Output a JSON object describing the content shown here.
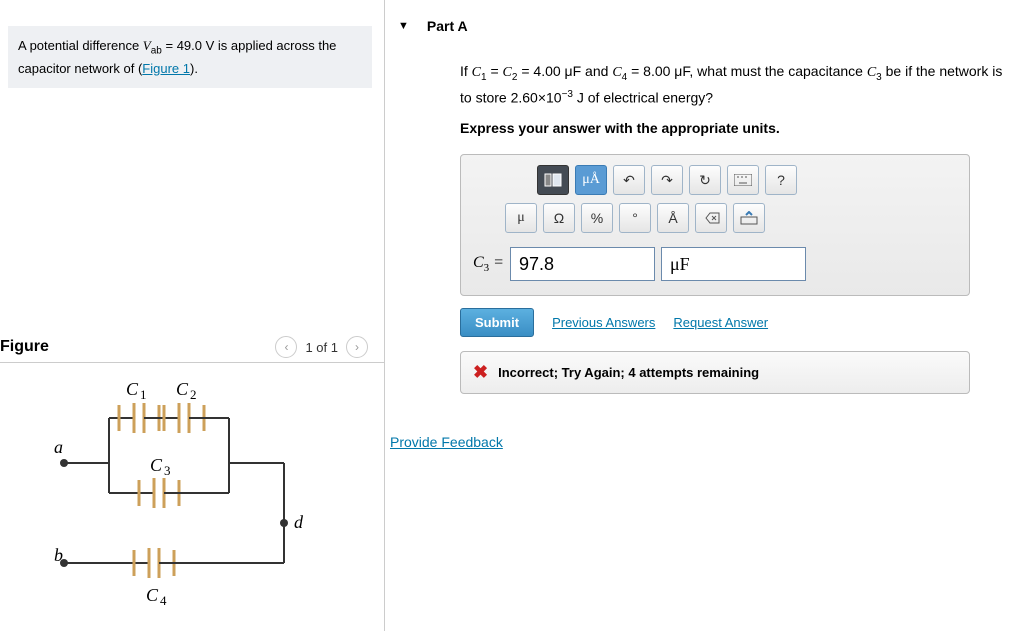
{
  "problem": {
    "text1_prefix": "A potential difference ",
    "var1": "V",
    "var1_sub": "ab",
    "text1_mid": " = 49.0 V is applied across the capacitor network of (",
    "link1": "Figure 1",
    "text1_suffix": ")."
  },
  "figure": {
    "title": "Figure",
    "page": "1 of 1",
    "labels": {
      "C1": "C",
      "C2": "C",
      "C3": "C",
      "C4": "C",
      "a": "a",
      "b": "b",
      "d": "d"
    }
  },
  "part": {
    "header": "Part A",
    "q_prefix": "If ",
    "q_c1_eq": " = ",
    "q_c2_prefix": " = 4.00 μF and ",
    "q_c4_val": " = 8.00 μF",
    "q_suffix": ", what must the capacitance ",
    "q_c3_suffix": " be if the network is to store 2.60×10",
    "q_exp": "−3",
    "q_tail": " J of electrical energy?",
    "instruction": "Express your answer with the appropriate units."
  },
  "toolbar": {
    "buttons_row1": [
      "template",
      "μÅ",
      "undo",
      "redo",
      "reset",
      "keyboard",
      "?"
    ],
    "buttons_row2": [
      "μ",
      "Ω",
      "%",
      "°",
      "Å",
      "backspace",
      "keyboard-up"
    ]
  },
  "answer": {
    "lhs": "C",
    "lhs_sub": "3",
    "equals": " = ",
    "value": "97.8",
    "units": "μF"
  },
  "actions": {
    "submit": "Submit",
    "previous": "Previous Answers",
    "request": "Request Answer"
  },
  "feedback": {
    "text": "Incorrect; Try Again; 4 attempts remaining"
  },
  "provide_feedback": "Provide Feedback"
}
